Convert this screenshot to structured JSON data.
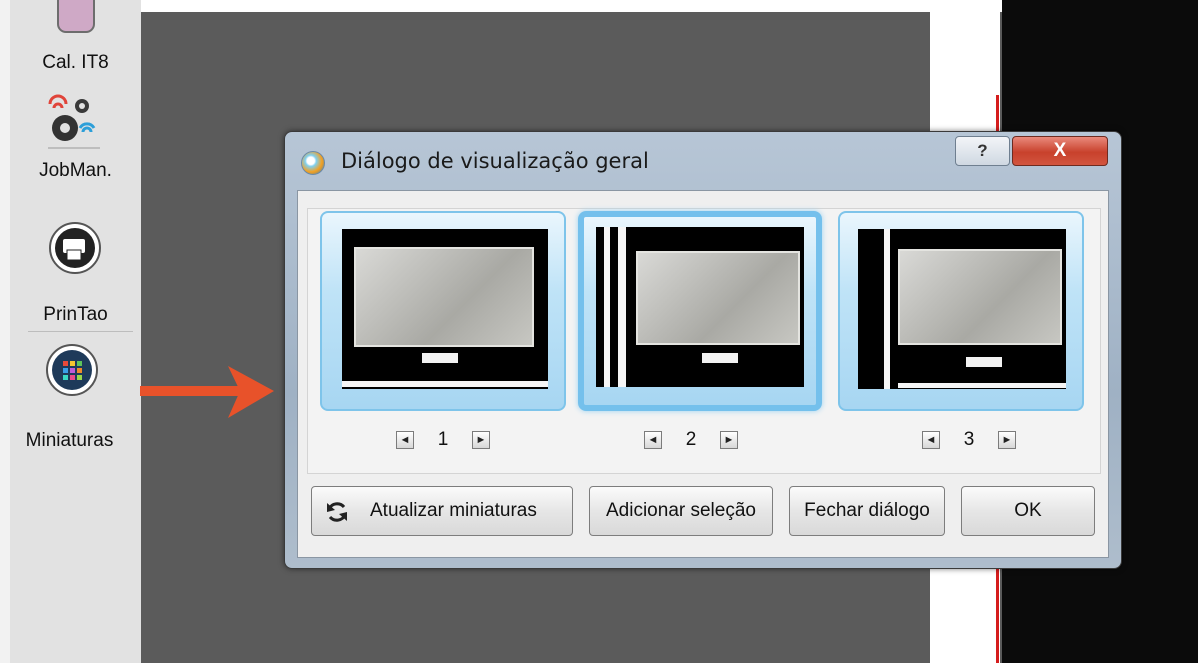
{
  "sidebar": {
    "items": [
      {
        "label": "Cal. IT8",
        "icon": "calibration-icon"
      },
      {
        "label": "JobMan.",
        "icon": "gears-icon"
      },
      {
        "label": "PrinTao",
        "icon": "printer-icon"
      },
      {
        "label": "Miniaturas",
        "icon": "thumbnails-grid-icon"
      }
    ]
  },
  "dialog": {
    "title": "Diálogo de visualização geral",
    "help_label": "?",
    "close_label": "X",
    "thumbnails": [
      {
        "number": "1",
        "selected": false
      },
      {
        "number": "2",
        "selected": true
      },
      {
        "number": "3",
        "selected": false
      }
    ],
    "nav_prev": "◄",
    "nav_next": "►",
    "buttons": {
      "refresh": "Atualizar miniaturas",
      "add_selection": "Adicionar seleção",
      "close_dialog": "Fechar diálogo",
      "ok": "OK"
    }
  },
  "colors": {
    "arrow": "#e8522a",
    "dialog_frame": "#a9bacb",
    "thumb_selected": "#74c0ec",
    "close_button": "#c8412c"
  }
}
